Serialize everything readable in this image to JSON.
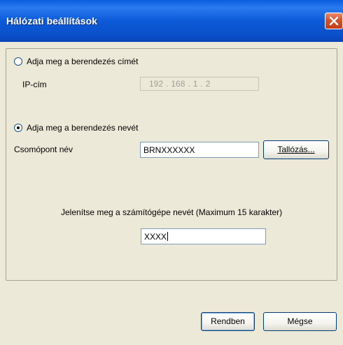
{
  "window": {
    "title": "Hálózati beállítások"
  },
  "options": {
    "by_address": {
      "label": "Adja meg a berendezés címét",
      "selected": false,
      "ip_label": "IP-cím",
      "ip_octets": [
        "192",
        "168",
        "1",
        "2"
      ]
    },
    "by_name": {
      "label": "Adja meg a berendezés nevét",
      "selected": true,
      "node_label": "Csomópont név",
      "node_value": "BRNXXXXXX",
      "browse_label": "Tallózás..."
    }
  },
  "computer_name": {
    "prompt": "Jelenítse meg a számítógépe nevét (Maximum 15 karakter)",
    "value": "XXXX"
  },
  "footer": {
    "ok_label": "Rendben",
    "cancel_label": "Mégse"
  }
}
